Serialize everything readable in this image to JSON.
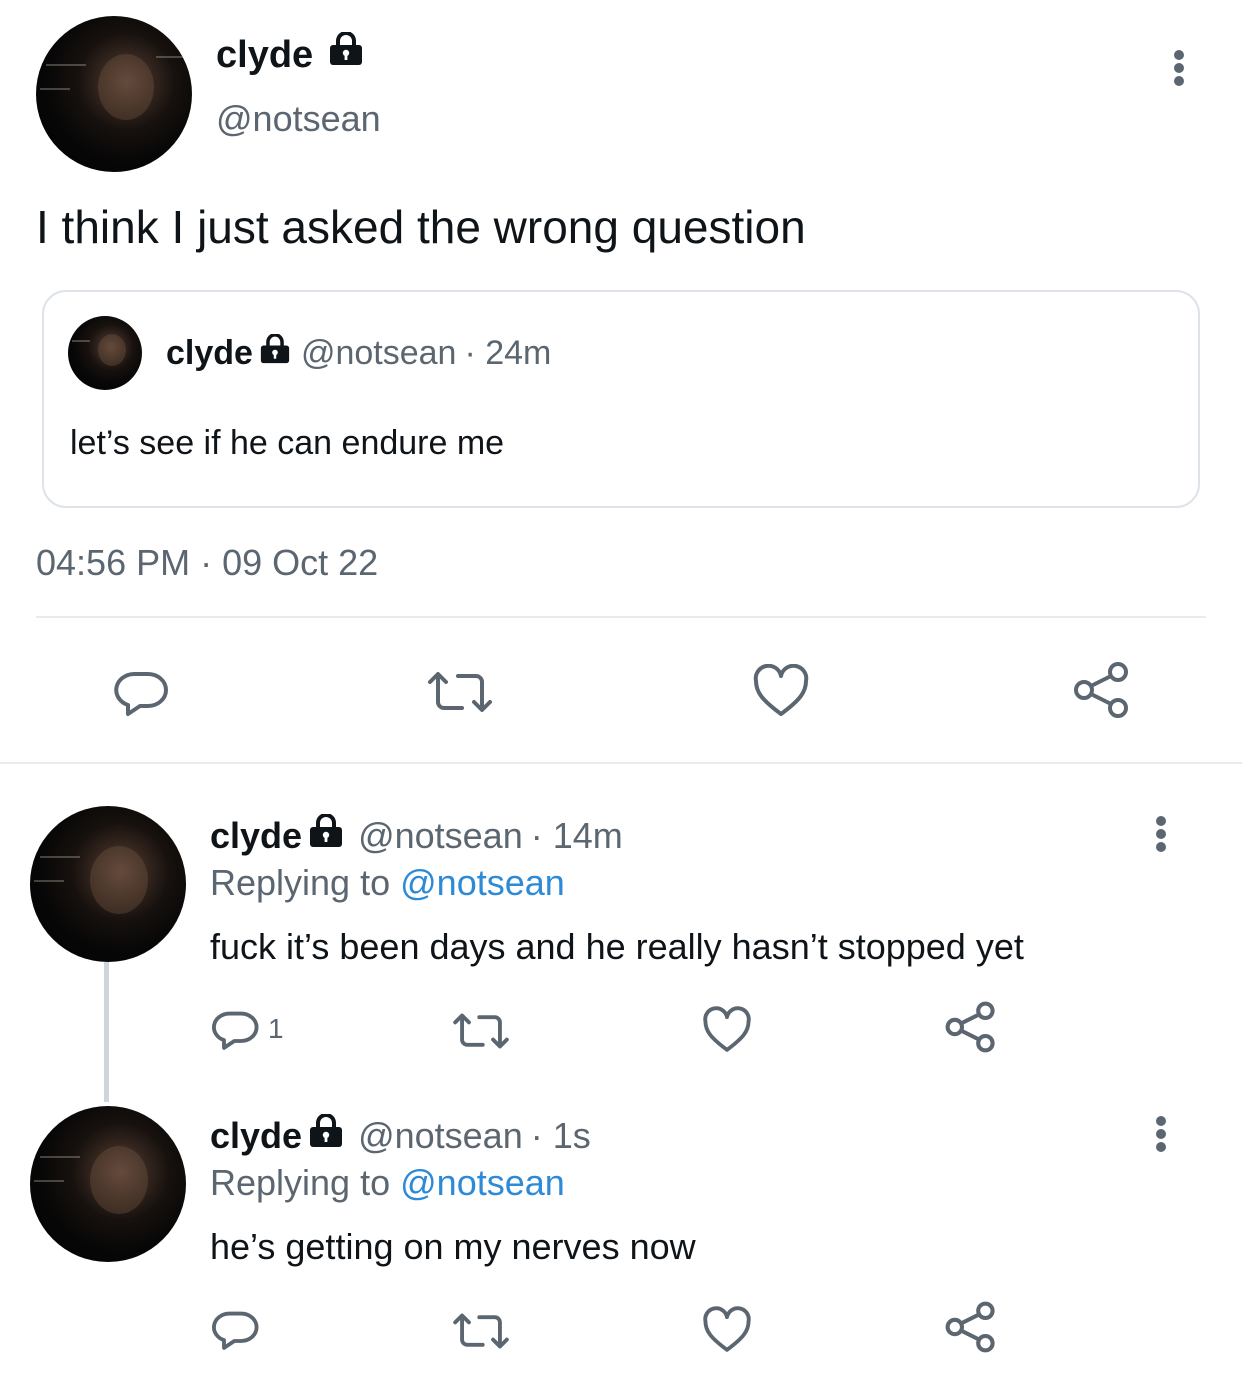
{
  "main_tweet": {
    "name": "clyde",
    "handle": "@notsean",
    "text": "I think I just asked the wrong question",
    "timestamp": "04:56 PM · 09 Oct 22",
    "quoted": {
      "name": "clyde",
      "handle": "@notsean",
      "time": "· 24m",
      "text": "let’s see if he can endure me"
    }
  },
  "replies": [
    {
      "name": "clyde",
      "handle": "@notsean",
      "time": "· 14m",
      "replying_prefix": "Replying to",
      "replying_to": "@notsean",
      "text": "fuck it’s been days and he really hasn’t stopped yet",
      "reply_count": "1"
    },
    {
      "name": "clyde",
      "handle": "@notsean",
      "time": "· 1s",
      "replying_prefix": "Replying to",
      "replying_to": "@notsean",
      "text": "he’s getting on my nerves now",
      "reply_count": ""
    }
  ],
  "icons": {
    "protected": "lock-icon",
    "more": "more-vertical-icon",
    "reply": "reply-icon",
    "retweet": "retweet-icon",
    "like": "heart-icon",
    "share": "share-icon"
  },
  "colors": {
    "text": "#0f1419",
    "muted": "#5b6670",
    "link": "#2d8ad6",
    "divider": "#e6ecf0"
  }
}
